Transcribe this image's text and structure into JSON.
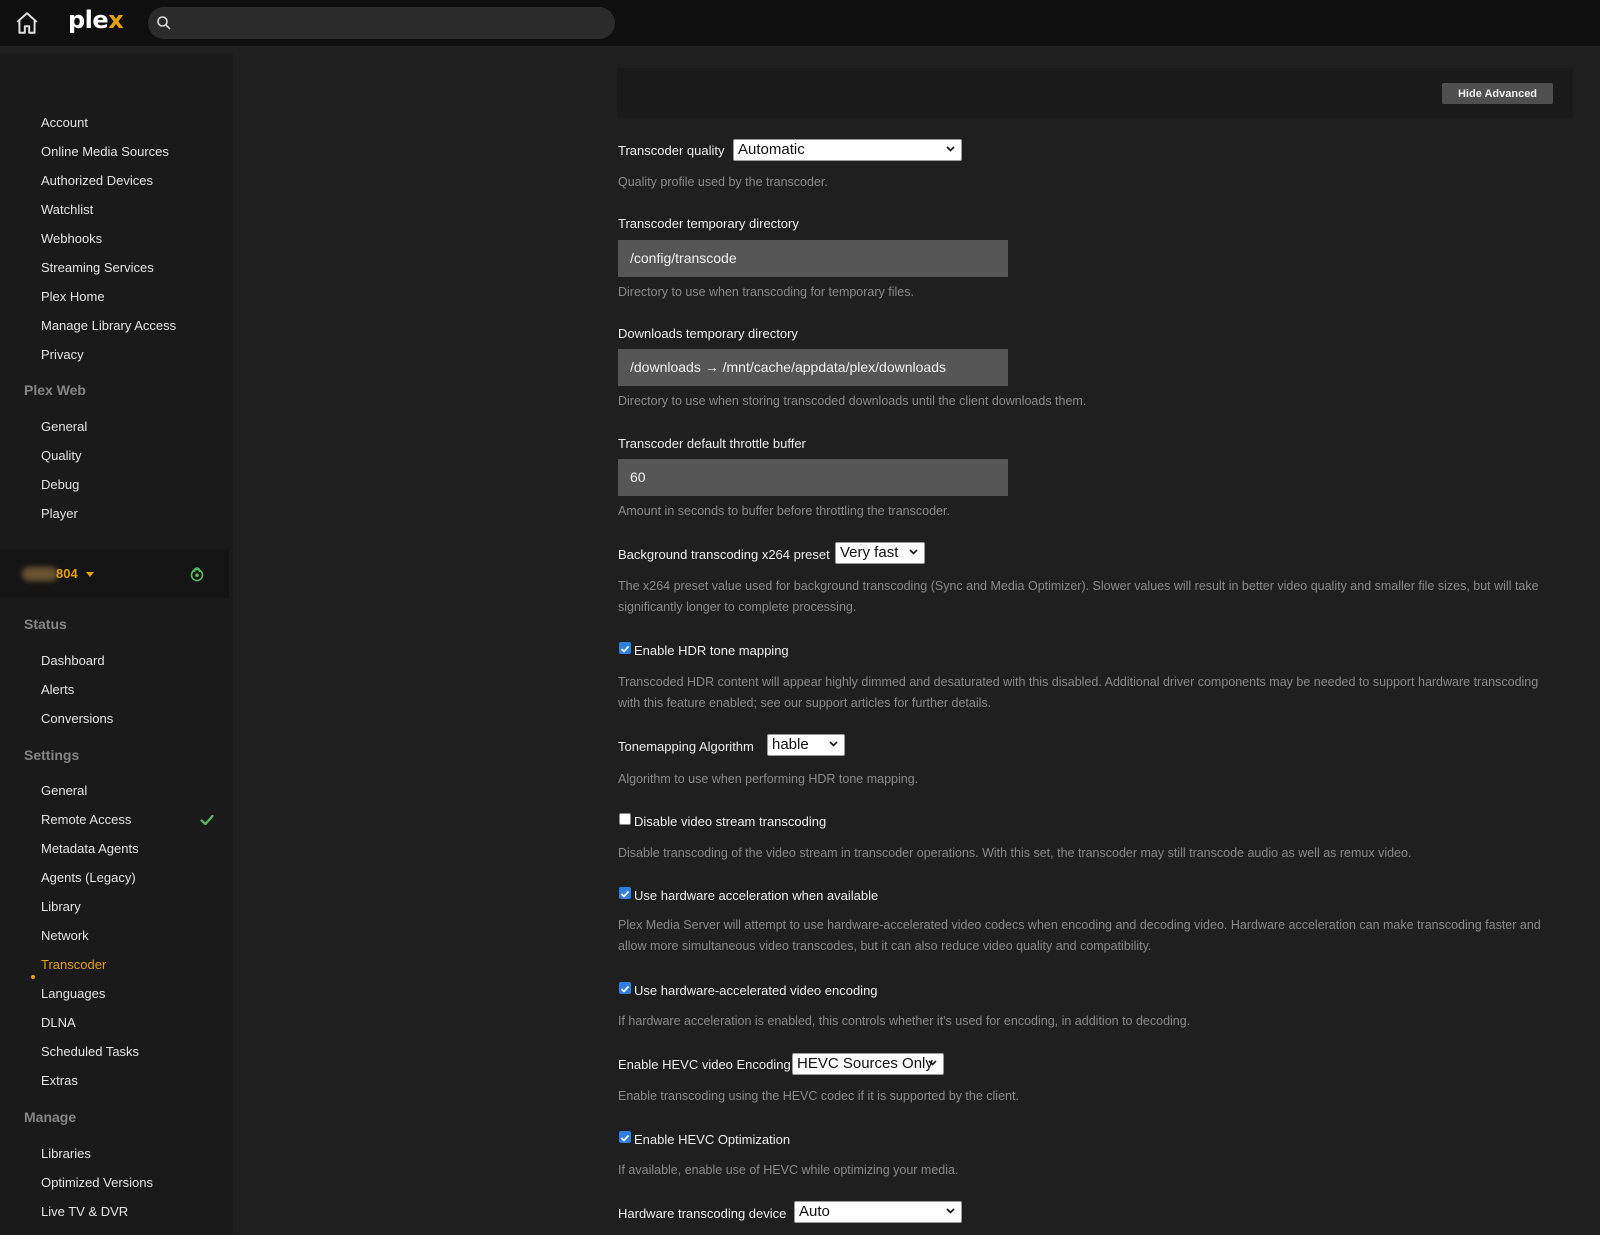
{
  "app": {
    "logo_main": "ple",
    "logo_accent": "x"
  },
  "search": {
    "placeholder": ""
  },
  "sidebar": {
    "account_items": [
      "Account",
      "Online Media Sources",
      "Authorized Devices",
      "Watchlist",
      "Webhooks",
      "Streaming Services",
      "Plex Home",
      "Manage Library Access",
      "Privacy"
    ],
    "plex_web_heading": "Plex Web",
    "plex_web_items": [
      "General",
      "Quality",
      "Debug",
      "Player"
    ],
    "server_name": "804",
    "status_heading": "Status",
    "status_items": [
      "Dashboard",
      "Alerts",
      "Conversions"
    ],
    "settings_heading": "Settings",
    "settings_items": [
      "General",
      "Remote Access",
      "Metadata Agents",
      "Agents (Legacy)",
      "Library",
      "Network",
      "Transcoder",
      "Languages",
      "DLNA",
      "Scheduled Tasks",
      "Extras"
    ],
    "active_item": "Transcoder",
    "manage_heading": "Manage",
    "manage_items": [
      "Libraries",
      "Optimized Versions",
      "Live TV & DVR"
    ]
  },
  "main": {
    "hide_advanced_label": "Hide Advanced",
    "transcoder_quality": {
      "label": "Transcoder quality",
      "value": "Automatic",
      "help": "Quality profile used by the transcoder."
    },
    "temp_dir": {
      "label": "Transcoder temporary directory",
      "value": "/config/transcode",
      "help": "Directory to use when transcoding for temporary files."
    },
    "downloads_dir": {
      "label": "Downloads temporary directory",
      "value": "/downloads → /mnt/cache/appdata/plex/downloads",
      "help": "Directory to use when storing transcoded downloads until the client downloads them."
    },
    "throttle": {
      "label": "Transcoder default throttle buffer",
      "value": "60",
      "help": "Amount in seconds to buffer before throttling the transcoder."
    },
    "x264_preset": {
      "label": "Background transcoding x264 preset",
      "value": "Very fast",
      "help": "The x264 preset value used for background transcoding (Sync and Media Optimizer). Slower values will result in better video quality and smaller file sizes, but will take significantly longer to complete processing."
    },
    "hdr_tone": {
      "label": "Enable HDR tone mapping",
      "checked": true,
      "help": "Transcoded HDR content will appear highly dimmed and desaturated with this disabled. Additional driver components may be needed to support hardware transcoding with this feature enabled; see our support articles for further details."
    },
    "tonemap_algo": {
      "label": "Tonemapping Algorithm",
      "value": "hable",
      "help": "Algorithm to use when performing HDR tone mapping."
    },
    "disable_video": {
      "label": "Disable video stream transcoding",
      "checked": false,
      "help": "Disable transcoding of the video stream in transcoder operations. With this set, the transcoder may still transcode audio as well as remux video."
    },
    "hw_accel": {
      "label": "Use hardware acceleration when available",
      "checked": true,
      "help": "Plex Media Server will attempt to use hardware-accelerated video codecs when encoding and decoding video. Hardware acceleration can make transcoding faster and allow more simultaneous video transcodes, but it can also reduce video quality and compatibility."
    },
    "hw_encoding": {
      "label": "Use hardware-accelerated video encoding",
      "checked": true,
      "help": "If hardware acceleration is enabled, this controls whether it's used for encoding, in addition to decoding."
    },
    "hevc_encoding": {
      "label": "Enable HEVC video Encoding",
      "value": "HEVC Sources Only",
      "help": "Enable transcoding using the HEVC codec if it is supported by the client."
    },
    "hevc_opt": {
      "label": "Enable HEVC Optimization",
      "checked": true,
      "help": "If available, enable use of HEVC while optimizing your media."
    },
    "hw_device": {
      "label": "Hardware transcoding device",
      "value": "Auto"
    }
  },
  "colors": {
    "accent": "#e5a00d",
    "checkbox": "#2f7fe0",
    "success": "#5cb85c"
  }
}
